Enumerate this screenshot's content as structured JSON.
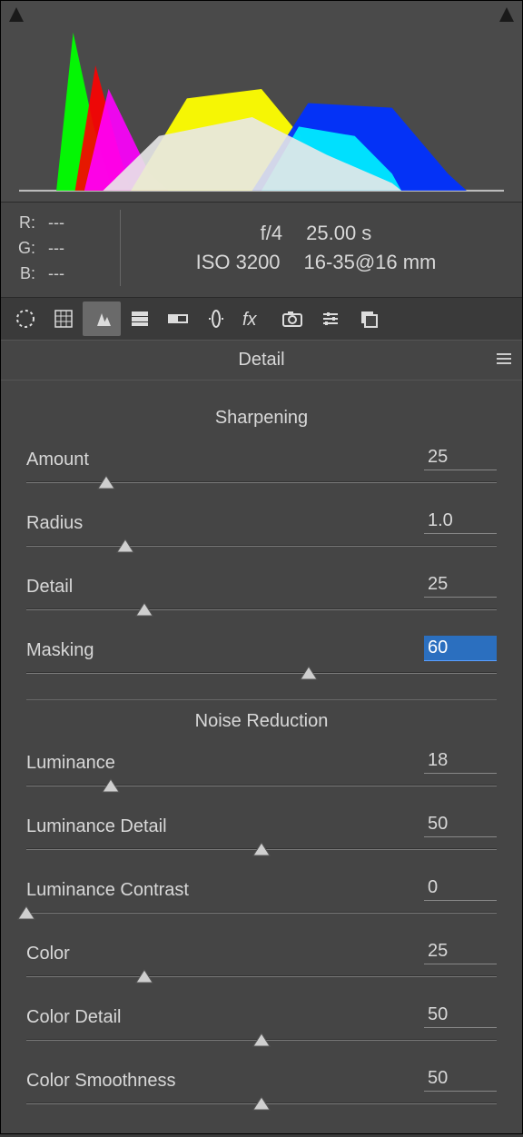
{
  "rgb": {
    "r_label": "R:",
    "g_label": "G:",
    "b_label": "B:",
    "r": "---",
    "g": "---",
    "b": "---"
  },
  "exif": {
    "aperture": "f/4",
    "shutter": "25.00 s",
    "iso": "ISO 3200",
    "lens": "16-35@16 mm"
  },
  "tabs": [
    {
      "name": "basic-icon"
    },
    {
      "name": "curve-icon"
    },
    {
      "name": "detail-icon"
    },
    {
      "name": "hsl-icon"
    },
    {
      "name": "split-icon"
    },
    {
      "name": "lens-icon"
    },
    {
      "name": "fx-icon"
    },
    {
      "name": "camera-icon"
    },
    {
      "name": "presets-icon"
    },
    {
      "name": "snapshots-icon"
    }
  ],
  "section_title": "Detail",
  "groups": {
    "sharpening_title": "Sharpening",
    "noise_title": "Noise Reduction"
  },
  "sliders": {
    "amount": {
      "label": "Amount",
      "value": "25",
      "pct": 17
    },
    "radius": {
      "label": "Radius",
      "value": "1.0",
      "pct": 21
    },
    "detail": {
      "label": "Detail",
      "value": "25",
      "pct": 25
    },
    "masking": {
      "label": "Masking",
      "value": "60",
      "pct": 60,
      "selected": true
    },
    "luminance": {
      "label": "Luminance",
      "value": "18",
      "pct": 18
    },
    "luminance_detail": {
      "label": "Luminance Detail",
      "value": "50",
      "pct": 50
    },
    "luminance_contrast": {
      "label": "Luminance Contrast",
      "value": "0",
      "pct": 0
    },
    "color": {
      "label": "Color",
      "value": "25",
      "pct": 25
    },
    "color_detail": {
      "label": "Color Detail",
      "value": "50",
      "pct": 50
    },
    "color_smoothness": {
      "label": "Color Smoothness",
      "value": "50",
      "pct": 50
    }
  }
}
